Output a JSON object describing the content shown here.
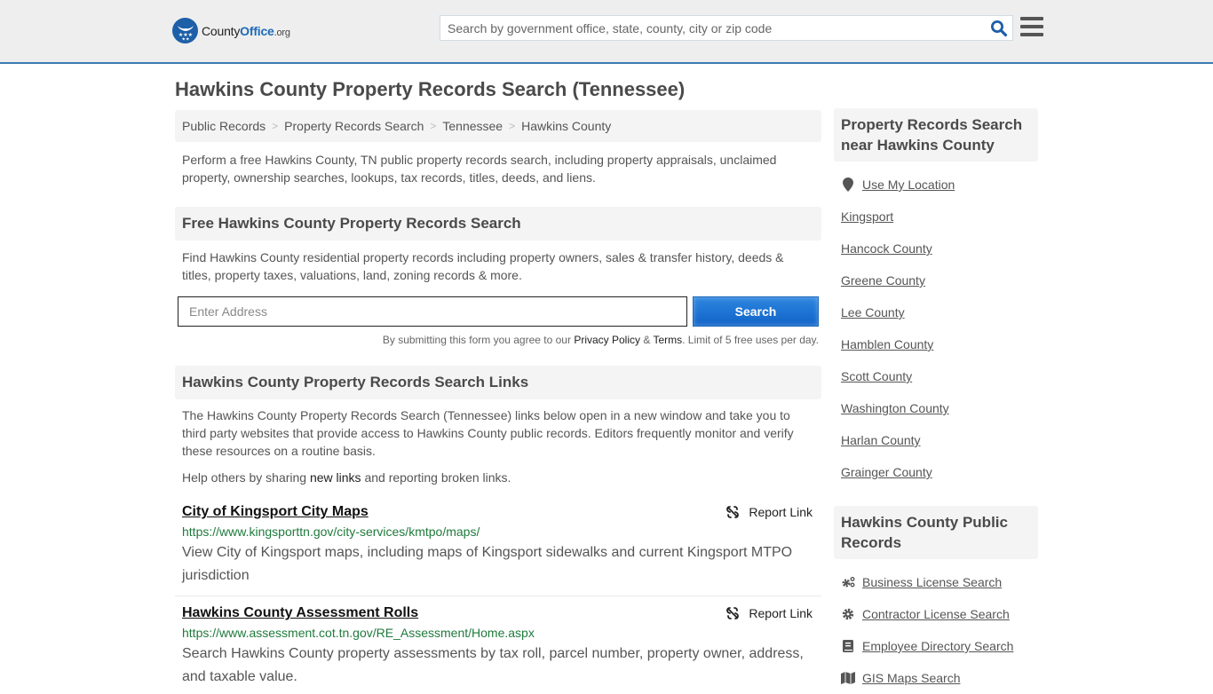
{
  "header": {
    "logo": {
      "name_part1": "County",
      "name_part2": "Office",
      "tld": ".org"
    },
    "search": {
      "placeholder": "Search by government office, state, county, city or zip code",
      "value": ""
    },
    "brand_color": "#1d5fa8",
    "accent_border_color": "#3a7bb0"
  },
  "page": {
    "title": "Hawkins County Property Records Search (Tennessee)"
  },
  "breadcrumb": [
    {
      "label": "Public Records"
    },
    {
      "label": "Property Records Search"
    },
    {
      "label": "Tennessee"
    },
    {
      "label": "Hawkins County"
    }
  ],
  "breadcrumb_separator": ">",
  "intro": "Perform a free Hawkins County, TN public property records search, including property appraisals, unclaimed property, ownership searches, lookups, tax records, titles, deeds, and liens.",
  "free_search": {
    "heading": "Free Hawkins County Property Records Search",
    "description": "Find Hawkins County residential property records including property owners, sales & transfer history, deeds & titles, property taxes, valuations, land, zoning records & more.",
    "address_placeholder": "Enter Address",
    "address_value": "",
    "button_label": "Search",
    "button_color": "#0f63c8",
    "disclaimer_prefix": "By submitting this form you agree to our ",
    "privacy_label": "Privacy Policy",
    "amp": " & ",
    "terms_label": "Terms",
    "disclaimer_suffix": ". Limit of 5 free uses per day."
  },
  "links_section": {
    "heading": "Hawkins County Property Records Search Links",
    "description": "The Hawkins County Property Records Search (Tennessee) links below open in a new window and take you to third party websites that provide access to Hawkins County public records. Editors frequently monitor and verify these resources on a routine basis.",
    "help_prefix": "Help others by sharing ",
    "help_link": "new links",
    "help_suffix": " and reporting broken links.",
    "report_label": "Report Link",
    "url_color": "#1f7a3c",
    "items": [
      {
        "title": "City of Kingsport City Maps",
        "url": "https://www.kingsporttn.gov/city-services/kmtpo/maps/",
        "description": "View City of Kingsport maps, including maps of Kingsport sidewalks and current Kingsport MTPO jurisdiction"
      },
      {
        "title": "Hawkins County Assessment Rolls",
        "url": "https://www.assessment.cot.tn.gov/RE_Assessment/Home.aspx",
        "description": "Search Hawkins County property assessments by tax roll, parcel number, property owner, address, and taxable value."
      }
    ]
  },
  "sidebar": {
    "nearby": {
      "heading": "Property Records Search near Hawkins County",
      "use_location": {
        "label": "Use My Location",
        "icon": "map-marker-icon"
      },
      "items": [
        {
          "label": "Kingsport"
        },
        {
          "label": "Hancock County"
        },
        {
          "label": "Greene County"
        },
        {
          "label": "Lee County"
        },
        {
          "label": "Hamblen County"
        },
        {
          "label": "Scott County"
        },
        {
          "label": "Washington County"
        },
        {
          "label": "Harlan County"
        },
        {
          "label": "Grainger County"
        }
      ]
    },
    "public_records": {
      "heading": "Hawkins County Public Records",
      "items": [
        {
          "label": "Business License Search",
          "icon": "gears-icon"
        },
        {
          "label": "Contractor License Search",
          "icon": "gear-icon"
        },
        {
          "label": "Employee Directory Search",
          "icon": "book-icon"
        },
        {
          "label": "GIS Maps Search",
          "icon": "map-icon"
        }
      ]
    }
  }
}
